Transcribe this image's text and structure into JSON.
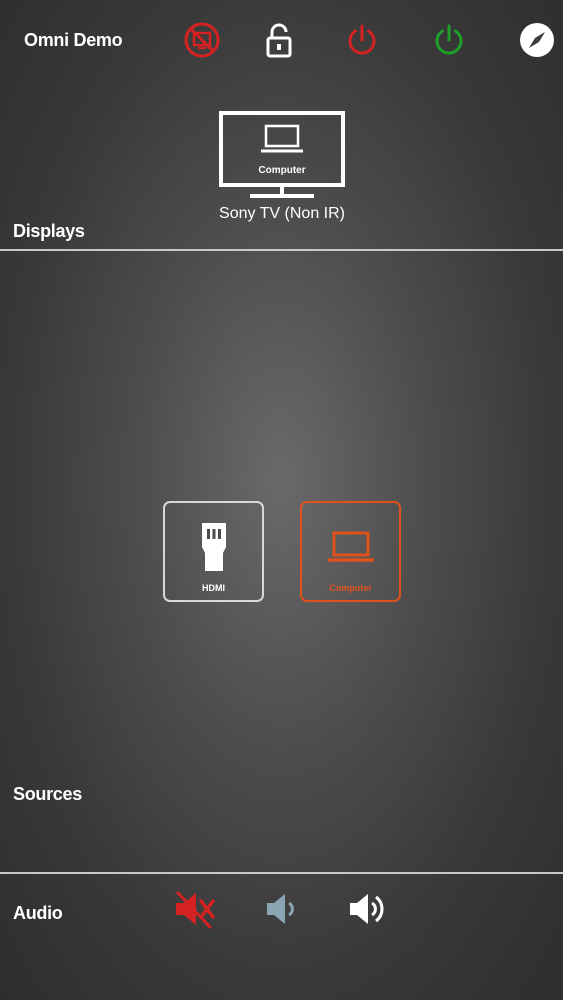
{
  "header": {
    "title": "Omni Demo",
    "icons": [
      "display-off-icon",
      "lock-open-icon",
      "power-off-icon",
      "power-on-icon",
      "compass-icon"
    ]
  },
  "displays": {
    "section_label": "Displays",
    "items": [
      {
        "name": "Sony TV (Non IR)",
        "current_source": "Computer"
      }
    ]
  },
  "sources": {
    "section_label": "Sources",
    "items": [
      {
        "label": "HDMI",
        "icon": "hdmi-icon",
        "active": false
      },
      {
        "label": "Computer",
        "icon": "laptop-icon",
        "active": true
      }
    ]
  },
  "audio": {
    "section_label": "Audio",
    "controls": [
      "mute-icon",
      "volume-down-icon",
      "volume-up-icon"
    ]
  },
  "colors": {
    "accent_orange": "#e0521c",
    "power_off_red": "#d42222",
    "power_on_green": "#1e9e2a",
    "mute_red": "#d42222",
    "volume_down_blue": "#8aa6b3"
  }
}
